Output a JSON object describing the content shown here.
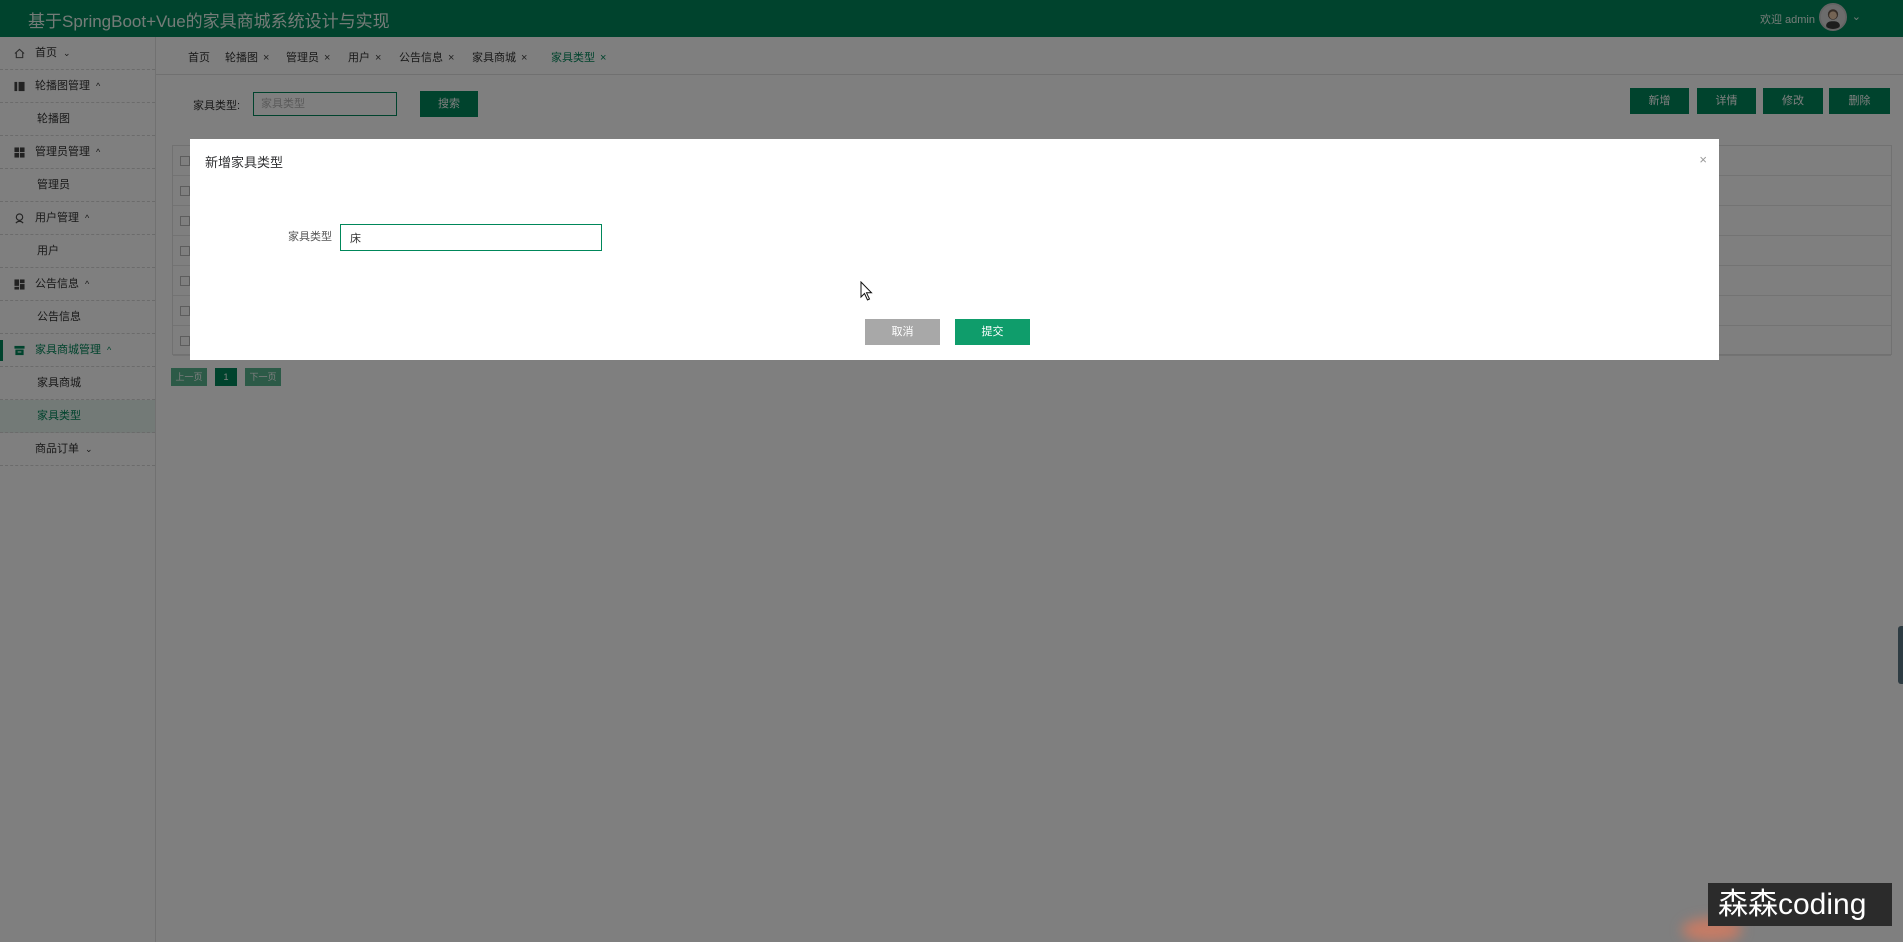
{
  "header": {
    "title": "基于SpringBoot+Vue的家具商城系统设计与实现",
    "welcome": "欢迎 admin",
    "chevron": "⌄"
  },
  "sidebar": {
    "items": [
      {
        "label": "首页",
        "icon": "home-icon",
        "type": "parent",
        "chevron": "⌄"
      },
      {
        "label": "轮播图管理",
        "icon": "columns-icon",
        "type": "parent",
        "chevron": "^"
      },
      {
        "label": "轮播图",
        "type": "child"
      },
      {
        "label": "管理员管理",
        "icon": "grid-icon",
        "type": "parent",
        "chevron": "^"
      },
      {
        "label": "管理员",
        "type": "child"
      },
      {
        "label": "用户管理",
        "icon": "user-icon",
        "type": "parent",
        "chevron": "^"
      },
      {
        "label": "用户",
        "type": "child"
      },
      {
        "label": "公告信息",
        "icon": "dashboard-icon",
        "type": "parent",
        "chevron": "^"
      },
      {
        "label": "公告信息",
        "type": "child"
      },
      {
        "label": "家具商城管理",
        "icon": "store-icon",
        "type": "parent",
        "chevron": "^",
        "active": true
      },
      {
        "label": "家具商城",
        "type": "child"
      },
      {
        "label": "家具类型",
        "type": "child",
        "active": true
      },
      {
        "label": "商品订单",
        "type": "child",
        "chevron": "⌄"
      }
    ]
  },
  "tabs": [
    {
      "label": "首页",
      "closable": false
    },
    {
      "label": "轮播图",
      "closable": true
    },
    {
      "label": "管理员",
      "closable": true
    },
    {
      "label": "用户",
      "closable": true
    },
    {
      "label": "公告信息",
      "closable": true
    },
    {
      "label": "家具商城",
      "closable": true
    },
    {
      "label": "家具类型",
      "closable": true,
      "active": true
    }
  ],
  "tab_close_glyph": "×",
  "search": {
    "label": "家具类型:",
    "placeholder": "家具类型",
    "button": "搜索"
  },
  "actions": {
    "add": "新增",
    "detail": "详情",
    "edit": "修改",
    "delete": "删除"
  },
  "pagination": {
    "prev": "上一页",
    "current": "1",
    "next": "下一页"
  },
  "dialog": {
    "title": "新增家具类型",
    "close": "×",
    "field_label": "家具类型",
    "field_value": "床",
    "cancel": "取消",
    "submit": "提交"
  },
  "watermark": "森森coding",
  "colors": {
    "brand": "#00875a",
    "submit": "#0f9d6b",
    "cancel": "#a8a8a8"
  }
}
